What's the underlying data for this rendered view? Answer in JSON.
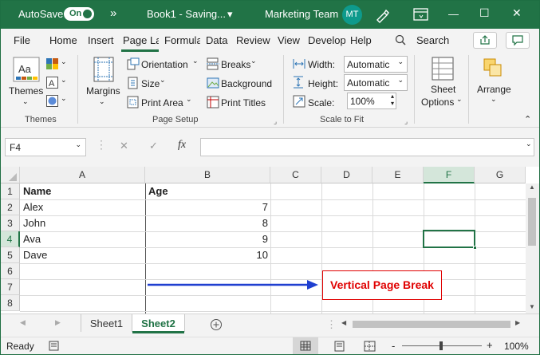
{
  "titlebar": {
    "autosave": "AutoSave",
    "toggle": "On",
    "more": "»",
    "doc": "Book1 - Saving...",
    "doc_caret": "▾",
    "team": "Marketing Team",
    "initials": "MT",
    "min": "—",
    "max": "☐",
    "close": "✕"
  },
  "tabs": [
    "File",
    "Home",
    "Insert",
    "Page La",
    "Formula",
    "Data",
    "Review",
    "View",
    "Develop",
    "Help"
  ],
  "search": "Search",
  "ribbon": {
    "themes": "Themes",
    "margins": "Margins",
    "orientation": "Orientation",
    "size": "Size",
    "print_area": "Print Area",
    "breaks": "Breaks",
    "background": "Background",
    "print_titles": "Print Titles",
    "width": "Width:",
    "height": "Height:",
    "scale": "Scale:",
    "width_val": "Automatic",
    "height_val": "Automatic",
    "scale_val": "100%",
    "sheet_options": "Sheet",
    "sheet_options2": "Options",
    "arrange": "Arrange",
    "group_themes": "Themes",
    "group_page_setup": "Page Setup",
    "group_scale": "Scale to Fit"
  },
  "formula": {
    "namebox": "F4",
    "fx": "fx",
    "value": ""
  },
  "columns": [
    "A",
    "B",
    "C",
    "D",
    "E",
    "F",
    "G"
  ],
  "rows": [
    "1",
    "2",
    "3",
    "4",
    "5",
    "6",
    "7",
    "8"
  ],
  "table": {
    "headers": [
      "Name",
      "Age"
    ],
    "rows": [
      [
        "Alex",
        "7"
      ],
      [
        "John",
        "8"
      ],
      [
        "Ava",
        "9"
      ],
      [
        "Dave",
        "10"
      ]
    ]
  },
  "annotation": "Vertical Page Break",
  "sheets": [
    "Sheet1",
    "Sheet2"
  ],
  "status": {
    "ready": "Ready",
    "zoom": "100%",
    "minus": "-",
    "plus": "+"
  },
  "colors": {
    "excel_green": "#217346",
    "annotation_red": "#e00000",
    "arrow_blue": "#1f3fd0"
  }
}
